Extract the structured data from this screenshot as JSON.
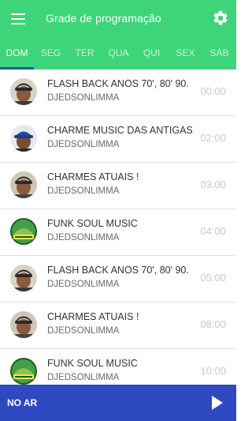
{
  "header": {
    "title": "Grade de programação",
    "menu_icon": "hamburger-menu-icon",
    "settings_icon": "gear-icon",
    "background": "#3ed57a"
  },
  "tabs": [
    {
      "label": "DOM",
      "active": true
    },
    {
      "label": "SEG",
      "active": false
    },
    {
      "label": "TER",
      "active": false
    },
    {
      "label": "QUA",
      "active": false
    },
    {
      "label": "QUI",
      "active": false
    },
    {
      "label": "SEX",
      "active": false
    },
    {
      "label": "SÁB",
      "active": false
    }
  ],
  "tab_indicator_color": "#2253a8",
  "schedule": [
    {
      "title": "FLASH BACK ANOS 70', 80' 90.",
      "host": "DJEDSONLIMMA",
      "time": "00:00",
      "avatar": "dj-photo-cap"
    },
    {
      "title": "CHARME MUSIC DAS ANTIGAS",
      "host": "DJEDSONLIMMA",
      "time": "02:00",
      "avatar": "dj-photo-blue-cap"
    },
    {
      "title": "CHARMES ATUAIS !",
      "host": "DJEDSONLIMMA",
      "time": "03:00",
      "avatar": "dj-photo-cap"
    },
    {
      "title": "FUNK SOUL MUSIC",
      "host": "DJEDSONLIMMA",
      "time": "04:00",
      "avatar": "green-logo"
    },
    {
      "title": "FLASH BACK ANOS 70', 80' 90.",
      "host": "DJEDSONLIMMA",
      "time": "05:00",
      "avatar": "dj-photo-cap"
    },
    {
      "title": "CHARMES ATUAIS !",
      "host": "DJEDSONLIMMA",
      "time": "08:00",
      "avatar": "dj-photo-cap"
    },
    {
      "title": "FUNK SOUL MUSIC",
      "host": "DJEDSONLIMMA",
      "time": "10:00",
      "avatar": "green-logo"
    }
  ],
  "player": {
    "label": "NO AR",
    "play_icon": "play-icon",
    "background": "#2f49c1"
  }
}
